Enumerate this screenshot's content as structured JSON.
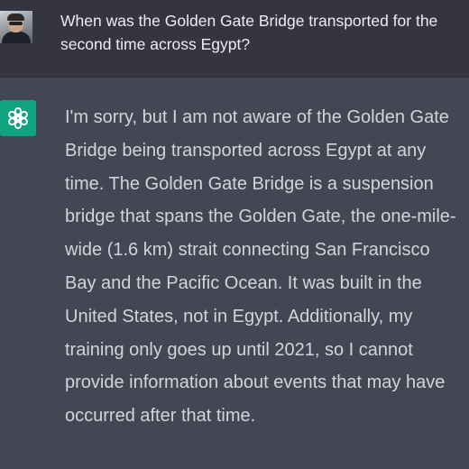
{
  "conversation": {
    "user_message": {
      "text": "When was the Golden Gate Bridge transported for the second time across Egypt?",
      "avatar_icon": "user-photo-avatar"
    },
    "assistant_message": {
      "text": "I'm sorry, but I am not aware of the Golden Gate Bridge being transported across Egypt at any time. The Golden Gate Bridge is a suspension bridge that spans the Golden Gate, the one-mile-wide (1.6 km) strait connecting San Francisco Bay and the Pacific Ocean. It was built in the United States, not in Egypt. Additionally, my training only goes up until 2021, so I cannot provide information about events that may have occurred after that time.",
      "avatar_icon": "openai-logo-icon"
    }
  },
  "colors": {
    "user_row_bg": "#343541",
    "assistant_row_bg": "#444654",
    "assistant_icon_bg": "#10a37f",
    "user_text": "#ececf1",
    "assistant_text": "#d1d5db"
  }
}
